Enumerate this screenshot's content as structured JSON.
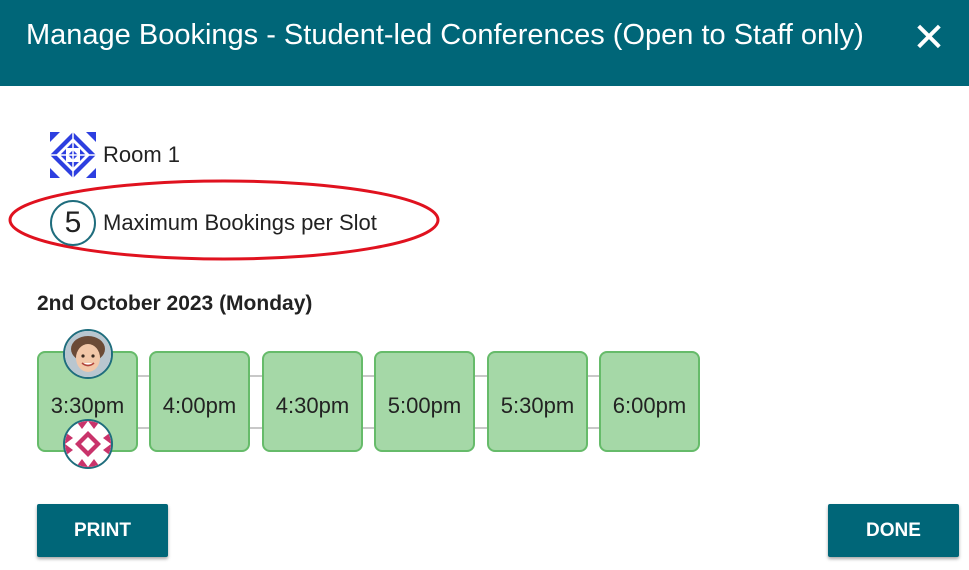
{
  "dialog": {
    "title": "Manage Bookings - Student-led Conferences (Open to Staff only)",
    "close_glyph": "✕"
  },
  "room": {
    "label": "Room 1",
    "icon": "quilt-pattern-icon"
  },
  "max_bookings": {
    "value": "5",
    "label": "Maximum Bookings per Slot"
  },
  "date_heading": "2nd October 2023 (Monday)",
  "slots": [
    {
      "time": "3:30pm"
    },
    {
      "time": "4:00pm"
    },
    {
      "time": "4:30pm"
    },
    {
      "time": "5:00pm"
    },
    {
      "time": "5:30pm"
    },
    {
      "time": "6:00pm"
    }
  ],
  "buttons": {
    "print": "PRINT",
    "done": "DONE"
  },
  "colors": {
    "header": "#006678",
    "slot_fill": "#a5d8a7",
    "slot_border": "#66bb6a",
    "highlight": "#e0121f"
  }
}
